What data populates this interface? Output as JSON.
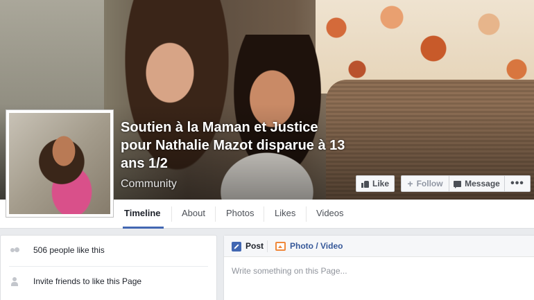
{
  "page": {
    "name": "Soutien à la Maman et Justice pour Nathalie Mazot disparue à 13 ans 1/2",
    "category": "Community"
  },
  "actions": {
    "like_label": "Like",
    "follow_label": "Follow",
    "message_label": "Message",
    "more_label": "•••"
  },
  "nav": {
    "tabs": [
      {
        "label": "Timeline",
        "active": true
      },
      {
        "label": "About"
      },
      {
        "label": "Photos"
      },
      {
        "label": "Likes"
      },
      {
        "label": "Videos"
      }
    ]
  },
  "sidebar": {
    "likes_text": "506 people like this",
    "invite_text": "Invite friends to like this Page"
  },
  "composer": {
    "tab_post": "Post",
    "tab_photo": "Photo / Video",
    "placeholder": "Write something on this Page..."
  },
  "colors": {
    "accent": "#4267b2",
    "link": "#365899",
    "background": "#e9ebee"
  },
  "icons": {
    "like": "thumbs-up-icon",
    "follow": "plus-icon",
    "message": "speech-bubble-icon",
    "more": "ellipsis-icon",
    "likes": "people-icon",
    "invite": "add-person-icon",
    "post": "pencil-icon",
    "photo": "photo-icon"
  }
}
